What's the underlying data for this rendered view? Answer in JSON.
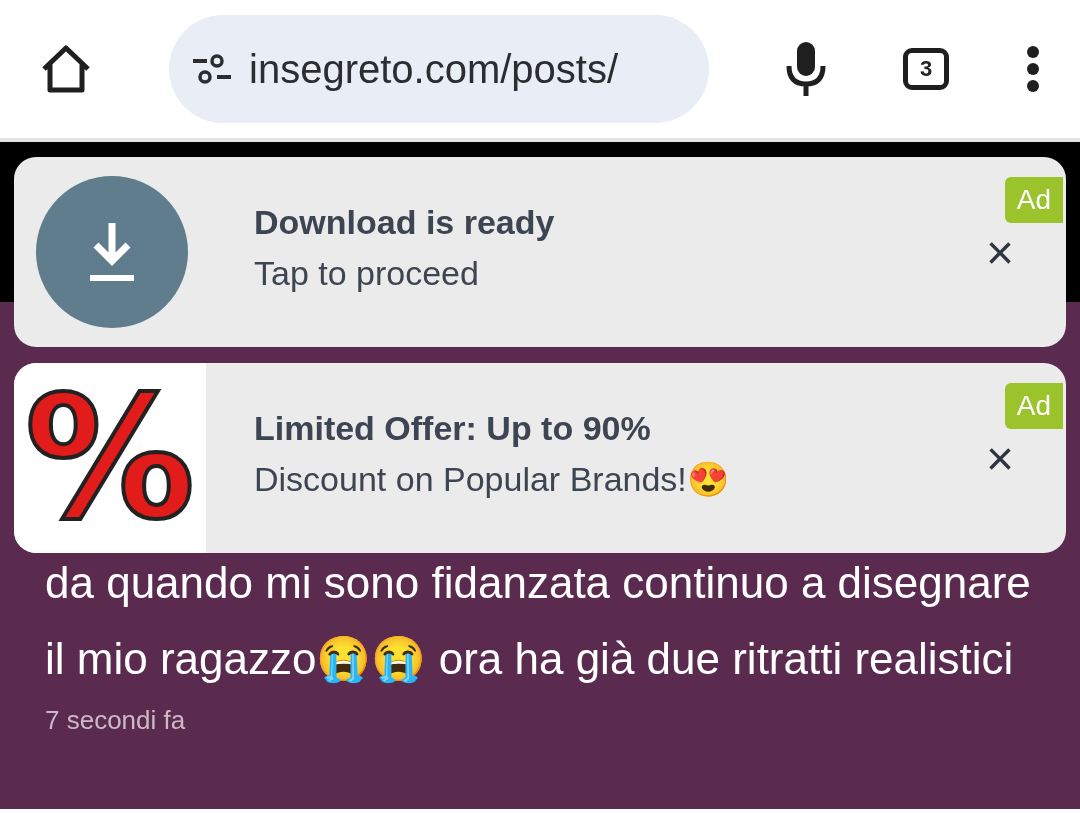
{
  "browser": {
    "url": "insegreto.com/posts/",
    "tab_count": "3"
  },
  "post": {
    "text": "da quando mi sono fidanzata continuo a disegnare il mio ragazzo😭😭 ora ha già due ritratti realistici",
    "time": "7 secondi fa"
  },
  "ads": [
    {
      "kind": "download",
      "title": "Download is ready",
      "subtitle": "Tap to proceed",
      "badge": "Ad",
      "close": "×"
    },
    {
      "kind": "offer",
      "glyph": "%",
      "title": "Limited Offer: Up to 90%",
      "subtitle": "Discount on Popular Brands!😍",
      "badge": "Ad",
      "close": "×"
    }
  ]
}
